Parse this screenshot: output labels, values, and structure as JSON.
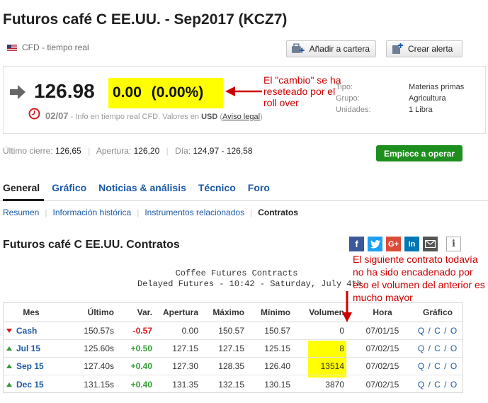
{
  "header": {
    "title": "Futuros café C EE.UU. - Sep2017 (KCZ7)",
    "subtitle": "CFD - tiempo real",
    "add_portfolio_label": "Añadir a cartera",
    "create_alert_label": "Crear alerta"
  },
  "quote": {
    "last": "126.98",
    "change": "0.00",
    "change_pct": "(0.00%)",
    "time": "02/07",
    "info_prefix": "- Info en tiempo real CFD. Valores en",
    "currency": "USD",
    "disclaimer_link": "Aviso legal",
    "paren_open": "(",
    "paren_close": ")"
  },
  "instrument_info": [
    {
      "key": "Tipo:",
      "value": "Materias primas"
    },
    {
      "key": "Grupo:",
      "value": "Agricultura"
    },
    {
      "key": "Unidades:",
      "value": "1 Libra"
    }
  ],
  "stats": {
    "prev_close_label": "Último cierre:",
    "prev_close": "126,65",
    "open_label": "Apertura:",
    "open": "126,20",
    "day_label": "Día:",
    "day_range": "124,97 - 126,58",
    "trade_button": "Empiece a operar"
  },
  "tabs": [
    "General",
    "Gráfico",
    "Noticias & análisis",
    "Técnico",
    "Foro"
  ],
  "subnav": [
    "Resumen",
    "Información histórica",
    "Instrumentos relacionados",
    "Contratos"
  ],
  "contracts": {
    "title": "Futuros café C EE.UU. Contratos",
    "header_line1": "Coffee Futures Contracts",
    "header_line2": "Delayed Futures - 10:42 - Saturday,",
    "header_date": "July 4th",
    "columns": [
      "Mes",
      "Último",
      "Var.",
      "Apertura",
      "Máximo",
      "Mínimo",
      "Volumen",
      "Hora",
      "Gráfico"
    ],
    "rows": [
      {
        "mes": "Cash",
        "ultimo": "150.57s",
        "var": "-0.57",
        "apertura": "0.00",
        "maximo": "150.57",
        "minimo": "150.57",
        "volumen": "0",
        "hora": "07/01/15",
        "grafico": "Q / C / O",
        "dir": "down"
      },
      {
        "mes": "Jul 15",
        "ultimo": "125.60s",
        "var": "+0.50",
        "apertura": "127.15",
        "maximo": "127.15",
        "minimo": "125.15",
        "volumen": "8",
        "hora": "07/02/15",
        "grafico": "Q / C / O",
        "dir": "up"
      },
      {
        "mes": "Sep 15",
        "ultimo": "127.40s",
        "var": "+0.40",
        "apertura": "127.30",
        "maximo": "128.35",
        "minimo": "126.40",
        "volumen": "13514",
        "hora": "07/02/15",
        "grafico": "Q / C / O",
        "dir": "up"
      },
      {
        "mes": "Dec 15",
        "ultimo": "131.15s",
        "var": "+0.40",
        "apertura": "131.35",
        "maximo": "132.15",
        "minimo": "130.15",
        "volumen": "3870",
        "hora": "07/02/15",
        "grafico": "Q / C / O",
        "dir": "up"
      }
    ]
  },
  "share": {
    "facebook": "f",
    "google": "G+",
    "linkedin": "in",
    "info": "i"
  },
  "annotations": {
    "roll_note": "El \"cambio\" se ha reseteado por el roll over",
    "volume_note": "El siguiente contrato todavía no ha sido encadenado por eso el volumen del anterior es mucho mayor"
  },
  "colors": {
    "link": "#1a5aa6",
    "positive": "#2e9e2e",
    "negative": "#d21b1b",
    "highlight": "#ffff00",
    "annotation": "#cc0000",
    "trade_button": "#1e8f1e"
  }
}
